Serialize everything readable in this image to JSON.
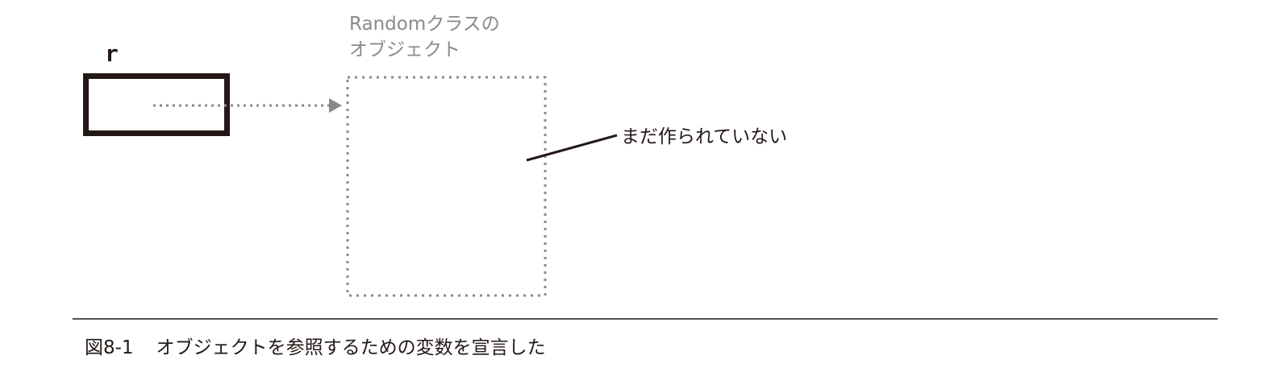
{
  "variable": {
    "name": "r"
  },
  "object": {
    "label_line1": "Randomクラスの",
    "label_line2": "オブジェクト"
  },
  "note": "まだ作られていない",
  "caption": {
    "number": "図8-1",
    "text": "オブジェクトを参照するための変数を宣言した"
  },
  "colors": {
    "ink": "#231815",
    "gray": "#8a8a8a"
  }
}
